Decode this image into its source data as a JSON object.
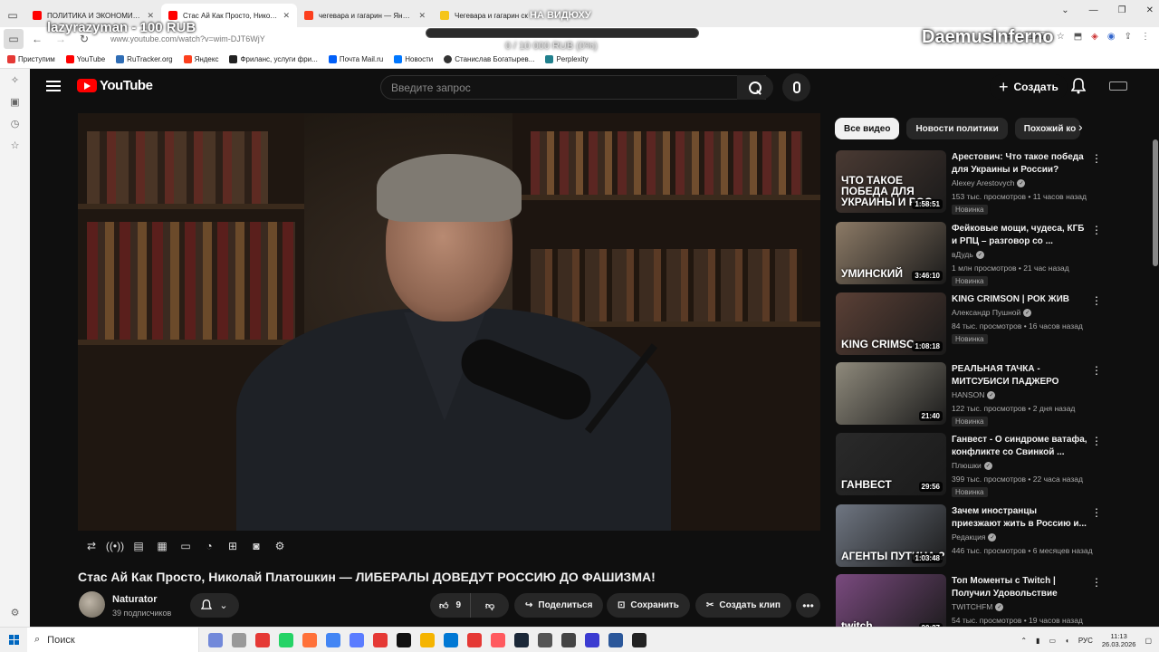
{
  "browser": {
    "tabs": [
      {
        "title": "ПОЛИТИКА И ЭКОНОМИКА И",
        "color": "#ff0000",
        "active": false
      },
      {
        "title": "Стас Ай Как Просто, Николай",
        "color": "#ff0000",
        "active": true
      },
      {
        "title": "чегевара и гагарин — Яндекс",
        "color": "#fc3f1d",
        "active": false
      },
      {
        "title": "Чегевара и гагарин ск",
        "color": "#f5c518",
        "active": false
      }
    ],
    "url": "www.youtube.com/watch?v=wim-DJT6WjY",
    "zoom": "110%",
    "bookmarks": [
      {
        "label": "Приступим",
        "color": "#e53935"
      },
      {
        "label": "YouTube",
        "color": "#ff0000"
      },
      {
        "label": "RuTracker.org",
        "color": "#2f6db5"
      },
      {
        "label": "Яндекс",
        "color": "#fc3f1d"
      },
      {
        "label": "Фриланс, услуги фри...",
        "color": "#222222"
      },
      {
        "label": "Почта Mail.ru",
        "color": "#005ff9"
      },
      {
        "label": "Новости",
        "color": "#0077ff"
      },
      {
        "label": "Станислав Богатырев...",
        "color": "#333333"
      },
      {
        "label": "Perplexity",
        "color": "#20808d"
      }
    ]
  },
  "overlay": {
    "user": "lazyrazyman - 100 RUB",
    "goal_title": "НА ВИДЮХУ",
    "goal_text": "0 / 10 000 RUB (0%)",
    "goal_progress": 0,
    "brand": "DaemusInferno"
  },
  "youtube": {
    "logo": "YouTube",
    "search_placeholder": "Введите запрос",
    "create_label": "Создать",
    "video": {
      "title": "Стас Ай Как Просто, Николай Платошкин — ЛИБЕРАЛЫ ДОВЕДУТ РОССИЮ ДО ФАШИЗМА!",
      "channel": "Naturator",
      "subscribers": "39 подписчиков",
      "likes": "9",
      "share_label": "Поделиться",
      "save_label": "Сохранить",
      "clip_label": "Создать клип"
    },
    "chips": [
      "Все видео",
      "Новости политики",
      "Похожий ко"
    ],
    "recommendations": [
      {
        "title": "Арестович: Что такое победа для Украины и России?",
        "channel": "Alexey Arestovych",
        "meta": "153 тыс. просмотров • 11 часов назад",
        "badge": "Новинка",
        "duration": "1:58:51",
        "caption": "ЧТО ТАКОЕ ПОБЕДА ДЛЯ УКРАИНЫ И РОС",
        "bg": "#4a3a33"
      },
      {
        "title": "Фейковые мощи, чудеса, КГБ и РПЦ – разговор со ...",
        "channel": "вДудь",
        "meta": "1 млн просмотров • 21 час назад",
        "badge": "Новинка",
        "duration": "3:46:10",
        "caption": "УМИНСКИЙ",
        "bg": "#8c7a66"
      },
      {
        "title": "KING CRIMSON | РОК ЖИВ",
        "channel": "Александр Пушной",
        "meta": "84 тыс. просмотров • 16 часов назад",
        "badge": "Новинка",
        "duration": "1:08:18",
        "caption": "KING CRIMSO",
        "bg": "#5b4036"
      },
      {
        "title": "РЕАЛЬНАЯ ТАЧКА - МИТСУБИСИ ПАДЖЕРО",
        "channel": "HANSON",
        "meta": "122 тыс. просмотров • 2 дня назад",
        "badge": "Новинка",
        "duration": "21:40",
        "caption": "",
        "bg": "#8f8a7c"
      },
      {
        "title": "Ганвест - О синдроме ватафа, конфликте со Свинкой ...",
        "channel": "Плюшки",
        "meta": "399 тыс. просмотров • 22 часа назад",
        "badge": "Новинка",
        "duration": "29:56",
        "caption": "ГАНВЕСТ",
        "bg": "#2a2a2a"
      },
      {
        "title": "Зачем иностранцы приезжают жить в Россию и...",
        "channel": "Редакция",
        "meta": "446 тыс. просмотров • 6 месяцев назад",
        "badge": "",
        "duration": "1:03:48",
        "caption": "АГЕНТЫ ПУТИНА ?",
        "bg": "#6f7682"
      },
      {
        "title": "Топ Моменты с Twitch | Получил Удовольствие",
        "channel": "TWITCHFM",
        "meta": "54 тыс. просмотров • 19 часов назад",
        "badge": "",
        "duration": "20:27",
        "caption": "twitch",
        "bg": "#7a4a7f"
      }
    ]
  },
  "taskbar": {
    "search_label": "Поиск",
    "lang": "РУС",
    "time": "11:13",
    "date": "26.03.2026",
    "apps": [
      "#7289da",
      "#999999",
      "#e53935",
      "#25d366",
      "#ff7139",
      "#4285f4",
      "#5a7cff",
      "#e53935",
      "#111111",
      "#f5b400",
      "#0078d4",
      "#e53935",
      "#ff5a5f",
      "#1b2838",
      "#555555",
      "#444444",
      "#3b3bd1",
      "#2b579a",
      "#222222"
    ]
  }
}
